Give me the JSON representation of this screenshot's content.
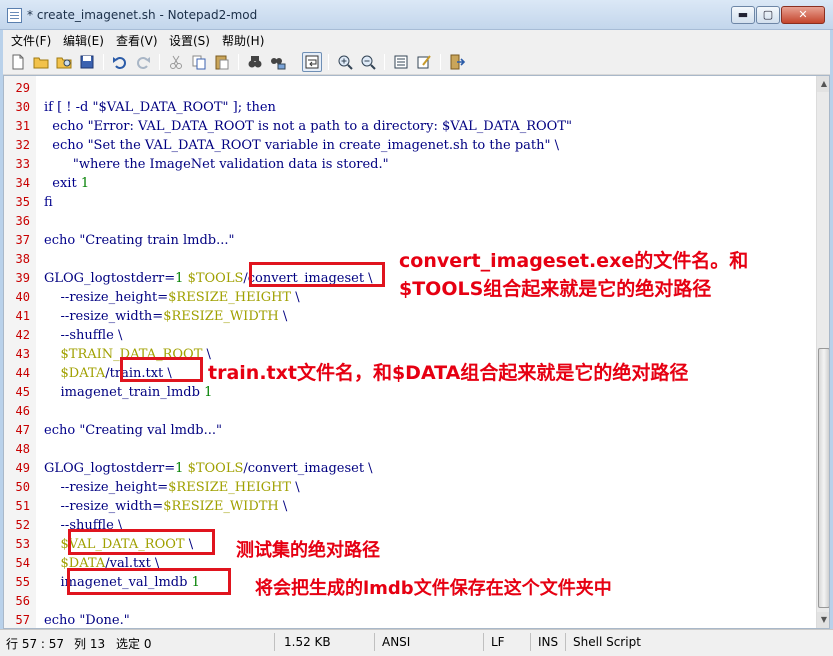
{
  "window": {
    "title": "* create_imagenet.sh - Notepad2-mod",
    "min_glyph": "▬",
    "max_glyph": "▢",
    "close_glyph": "✕"
  },
  "menu": [
    "文件(F)",
    "编辑(E)",
    "查看(V)",
    "设置(S)",
    "帮助(H)"
  ],
  "toolbar_icons": [
    "new-file-icon",
    "open-folder-icon",
    "browse-icon",
    "save-icon",
    "undo-icon",
    "redo-icon",
    "cut-icon",
    "copy-icon",
    "paste-icon",
    "find-icon",
    "replace-icon",
    "word-wrap-icon",
    "zoom-in-icon",
    "zoom-out-icon",
    "select-scheme-icon",
    "customize-scheme-icon",
    "exit-icon"
  ],
  "editor": {
    "lines": [
      {
        "n": "29",
        "segs": []
      },
      {
        "n": "30",
        "segs": [
          [
            "kw",
            "if [ ! -d "
          ],
          [
            "str",
            "\"$VAL_DATA_ROOT\""
          ],
          [
            "kw",
            " ]; then"
          ]
        ]
      },
      {
        "n": "31",
        "segs": [
          [
            "kw",
            "  echo "
          ],
          [
            "str",
            "\"Error: VAL_DATA_ROOT is not a path to a directory: $VAL_DATA_ROOT\""
          ]
        ]
      },
      {
        "n": "32",
        "segs": [
          [
            "kw",
            "  echo "
          ],
          [
            "str",
            "\"Set the VAL_DATA_ROOT variable in create_imagenet.sh to the path\""
          ],
          [
            "plain",
            " \\"
          ]
        ]
      },
      {
        "n": "33",
        "segs": [
          [
            "str",
            "       \"where the ImageNet validation data is stored.\""
          ]
        ]
      },
      {
        "n": "34",
        "segs": [
          [
            "kw",
            "  exit "
          ],
          [
            "num",
            "1"
          ]
        ]
      },
      {
        "n": "35",
        "segs": [
          [
            "kw",
            "fi"
          ]
        ]
      },
      {
        "n": "36",
        "segs": []
      },
      {
        "n": "37",
        "segs": [
          [
            "kw",
            "echo "
          ],
          [
            "str",
            "\"Creating train lmdb...\""
          ]
        ]
      },
      {
        "n": "38",
        "segs": []
      },
      {
        "n": "39",
        "segs": [
          [
            "plain",
            "GLOG_logtostderr="
          ],
          [
            "num",
            "1"
          ],
          [
            "plain",
            " "
          ],
          [
            "var",
            "$TOOLS"
          ],
          [
            "plain",
            "/convert_imageset \\"
          ]
        ]
      },
      {
        "n": "40",
        "segs": [
          [
            "plain",
            "    --resize_height="
          ],
          [
            "var",
            "$RESIZE_HEIGHT"
          ],
          [
            "plain",
            " \\"
          ]
        ]
      },
      {
        "n": "41",
        "segs": [
          [
            "plain",
            "    --resize_width="
          ],
          [
            "var",
            "$RESIZE_WIDTH"
          ],
          [
            "plain",
            " \\"
          ]
        ]
      },
      {
        "n": "42",
        "segs": [
          [
            "plain",
            "    --shuffle \\"
          ]
        ]
      },
      {
        "n": "43",
        "segs": [
          [
            "var",
            "    $TRAIN_DATA_ROOT"
          ],
          [
            "plain",
            " \\"
          ]
        ]
      },
      {
        "n": "44",
        "segs": [
          [
            "var",
            "    $DATA"
          ],
          [
            "plain",
            "/train.txt \\"
          ]
        ]
      },
      {
        "n": "45",
        "segs": [
          [
            "plain",
            "    imagenet_train_lmdb "
          ],
          [
            "num",
            "1"
          ]
        ]
      },
      {
        "n": "46",
        "segs": []
      },
      {
        "n": "47",
        "segs": [
          [
            "kw",
            "echo "
          ],
          [
            "str",
            "\"Creating val lmdb...\""
          ]
        ]
      },
      {
        "n": "48",
        "segs": []
      },
      {
        "n": "49",
        "segs": [
          [
            "plain",
            "GLOG_logtostderr="
          ],
          [
            "num",
            "1"
          ],
          [
            "plain",
            " "
          ],
          [
            "var",
            "$TOOLS"
          ],
          [
            "plain",
            "/convert_imageset \\"
          ]
        ]
      },
      {
        "n": "50",
        "segs": [
          [
            "plain",
            "    --resize_height="
          ],
          [
            "var",
            "$RESIZE_HEIGHT"
          ],
          [
            "plain",
            " \\"
          ]
        ]
      },
      {
        "n": "51",
        "segs": [
          [
            "plain",
            "    --resize_width="
          ],
          [
            "var",
            "$RESIZE_WIDTH"
          ],
          [
            "plain",
            " \\"
          ]
        ]
      },
      {
        "n": "52",
        "segs": [
          [
            "plain",
            "    --shuffle \\"
          ]
        ]
      },
      {
        "n": "53",
        "segs": [
          [
            "var",
            "    $VAL_DATA_ROOT"
          ],
          [
            "plain",
            " \\"
          ]
        ]
      },
      {
        "n": "54",
        "segs": [
          [
            "var",
            "    $DATA"
          ],
          [
            "plain",
            "/val.txt \\"
          ]
        ]
      },
      {
        "n": "55",
        "segs": [
          [
            "plain",
            "    imagenet_val_lmdb "
          ],
          [
            "num",
            "1"
          ]
        ]
      },
      {
        "n": "56",
        "segs": []
      },
      {
        "n": "57",
        "segs": [
          [
            "kw",
            "echo "
          ],
          [
            "str",
            "\"Done.\""
          ]
        ]
      }
    ]
  },
  "annotations": {
    "a1_line1": "convert_imageset.exe的文件名。和",
    "a1_line2": "$TOOLS组合起来就是它的绝对路径",
    "a2": "train.txt文件名，和$DATA组合起来就是它的绝对路径",
    "a3": "测试集的绝对路径",
    "a4": "将会把生成的lmdb文件保存在这个文件夹中"
  },
  "status": {
    "position": "行 57 : 57",
    "column": "列 13",
    "selection": "选定 0",
    "size": "1.52 KB",
    "encoding": "ANSI",
    "line_ending": "LF",
    "mode": "INS",
    "scheme": "Shell Script"
  },
  "colors": {
    "annotation": "#e60012",
    "line_number": "#c80000",
    "variable": "#a0a000",
    "number": "#008000",
    "text": "#000080"
  }
}
